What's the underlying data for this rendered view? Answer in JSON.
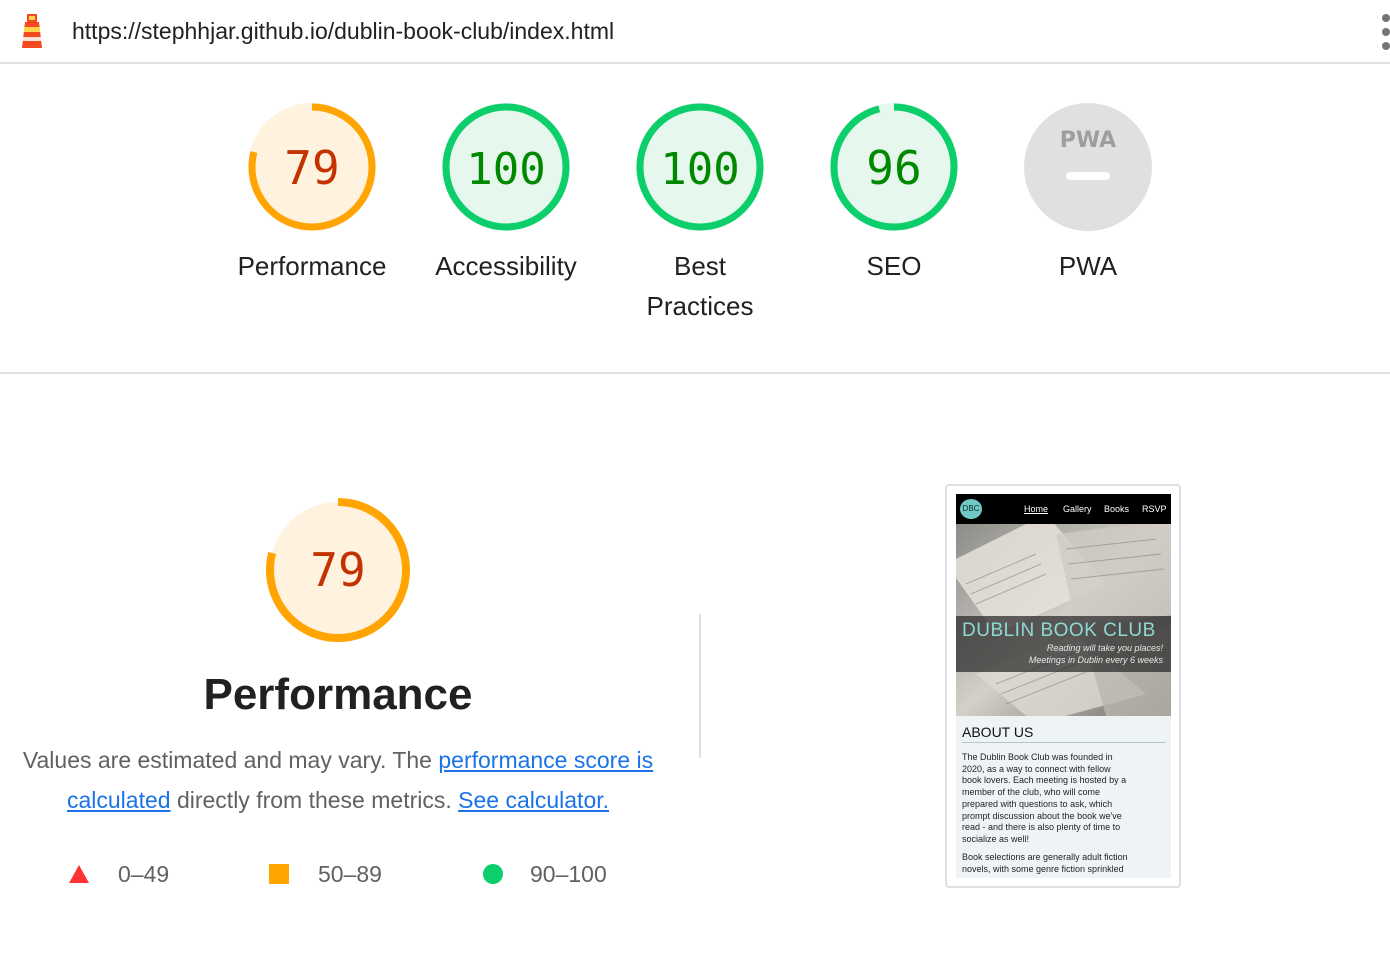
{
  "url_bar": {
    "url": "https://stephhjar.github.io/dublin-book-club/index.html"
  },
  "colors": {
    "fail": "#ff3333",
    "average": "#ffa400",
    "average_text": "#c33300",
    "average_bg": "#fff3e0",
    "pass": "#0cce6b",
    "pass_text": "#008800",
    "pass_bg": "#e6f8ee",
    "na": "#e0e0e0",
    "na_icon": "#9e9e9e",
    "link": "#1a73e8"
  },
  "scores": [
    {
      "label_line1": "Performance",
      "label_line2": "",
      "score": 79,
      "score_text": "79",
      "rating": "average"
    },
    {
      "label_line1": "Accessibility",
      "label_line2": "",
      "score": 100,
      "score_text": "100",
      "rating": "pass"
    },
    {
      "label_line1": "Best",
      "label_line2": "Practices",
      "score": 100,
      "score_text": "100",
      "rating": "pass"
    },
    {
      "label_line1": "SEO",
      "label_line2": "",
      "score": 96,
      "score_text": "96",
      "rating": "pass"
    },
    {
      "label_line1": "PWA",
      "label_line2": "",
      "score": null,
      "score_text": "PWA",
      "rating": "na"
    }
  ],
  "performance": {
    "score": 79,
    "score_text": "79",
    "title": "Performance",
    "desc_pre": "Values are estimated and may vary. The ",
    "link1": "performance score is calculated",
    "desc_mid": " directly from these metrics. ",
    "link2": "See calculator."
  },
  "legend": [
    {
      "icon": "red-triangle-icon",
      "range": "0–49"
    },
    {
      "icon": "orange-square-icon",
      "range": "50–89"
    },
    {
      "icon": "green-circle-icon",
      "range": "90–100"
    }
  ],
  "screenshot": {
    "logo": "DBC",
    "nav": [
      "Home",
      "Gallery",
      "Books",
      "RSVP"
    ],
    "title": "DUBLIN BOOK CLUB",
    "tagline1": "Reading will take you places!",
    "tagline2": "Meetings in Dublin every 6 weeks",
    "about_heading": "ABOUT US",
    "para1_lines": [
      "The Dublin Book Club was founded in",
      "2020, as a way to connect with fellow",
      "book lovers. Each meeting is hosted by a",
      "member of the club, who will come",
      "prepared with questions to ask, which",
      "prompt discussion about the book we've",
      "read - and there is also plenty of time to",
      "socialize as well!"
    ],
    "para2_lines": [
      "Book selections are generally adult fiction",
      "novels, with some genre fiction sprinkled"
    ]
  }
}
